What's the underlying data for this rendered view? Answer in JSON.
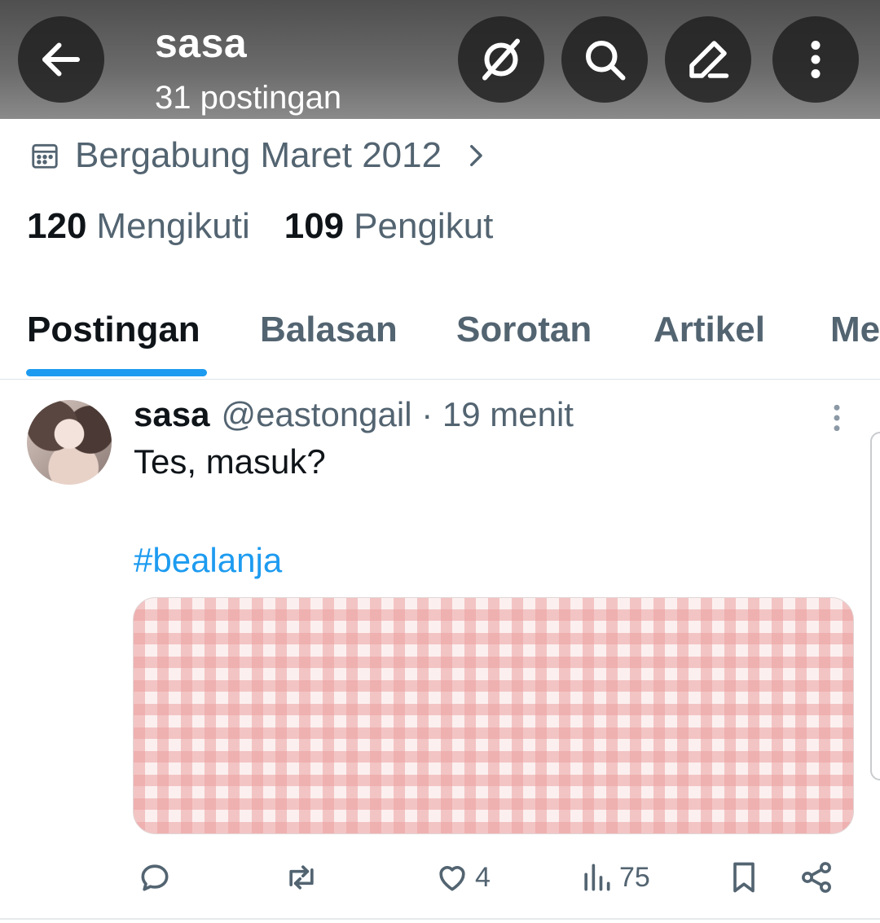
{
  "header": {
    "name": "sasa",
    "post_count": "31 postingan",
    "icons": [
      "back-arrow-icon",
      "grok-icon",
      "search-icon",
      "edit-icon",
      "more-vertical-icon"
    ]
  },
  "profile": {
    "joined": "Bergabung Maret 2012",
    "following_count": "120",
    "following_label": "Mengikuti",
    "followers_count": "109",
    "followers_label": "Pengikut"
  },
  "tabs": [
    {
      "label": "Postingan",
      "active": true
    },
    {
      "label": "Balasan",
      "active": false
    },
    {
      "label": "Sorotan",
      "active": false
    },
    {
      "label": "Artikel",
      "active": false
    },
    {
      "label": "Me",
      "active": false
    }
  ],
  "post": {
    "display_name": "sasa",
    "handle": "@eastongail",
    "time": "· 19 menit",
    "text": "Tes, masuk?",
    "hashtag": "#bealanja",
    "actions": {
      "reply_count": "",
      "repost_count": "",
      "like_count": "4",
      "views_count": "75"
    }
  },
  "colors": {
    "accent": "#1d9bf0",
    "text_primary": "#0f1419",
    "text_secondary": "#536471"
  }
}
